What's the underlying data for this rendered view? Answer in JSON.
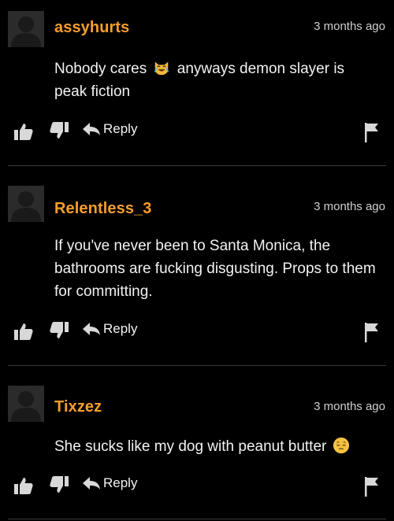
{
  "comments": [
    {
      "username": "assyhurts",
      "time": "3 months ago",
      "text_before_emoji": "Nobody cares",
      "emoji": "crying-laughing-cat-emoji",
      "text_after_emoji": "anyways demon slayer is peak fiction",
      "reply_label": "Reply"
    },
    {
      "username": "Relentless_3",
      "time": "3 months ago",
      "text": "If you've never been to Santa Monica, the bathrooms are fucking disgusting. Props to them for committing.",
      "reply_label": "Reply"
    },
    {
      "username": "Tixzez",
      "time": "3 months ago",
      "text_before_emoji": "She sucks like my dog with peanut butter",
      "emoji": "pensive-face-emoji",
      "reply_label": "Reply"
    }
  ],
  "colors": {
    "background": "#000000",
    "username": "#f79e2c",
    "text": "#f2f2f2",
    "icons": "#d8d8d8",
    "divider": "#3b3b3b"
  },
  "icons": [
    "thumbs-up-icon",
    "thumbs-down-icon",
    "reply-arrow-icon",
    "flag-icon",
    "avatar-placeholder-icon"
  ]
}
